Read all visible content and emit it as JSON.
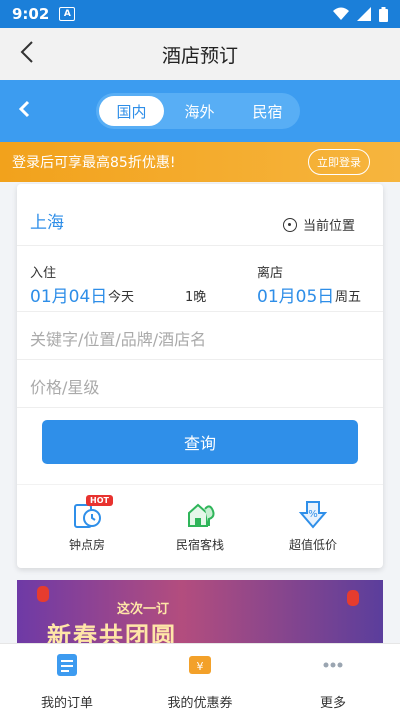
{
  "status": {
    "time": "9:02",
    "app_icon": "A"
  },
  "header": {
    "title": "酒店预订"
  },
  "tabs": [
    {
      "label": "国内",
      "active": true
    },
    {
      "label": "海外",
      "active": false
    },
    {
      "label": "民宿",
      "active": false
    }
  ],
  "promo": {
    "text": "登录后可享最高85折优惠!",
    "button": "立即登录"
  },
  "search": {
    "city": "上海",
    "location_label": "当前位置",
    "checkin_label": "入住",
    "checkin_date": "01月04日",
    "checkin_day": "今天",
    "nights": "1晚",
    "checkout_label": "离店",
    "checkout_date": "01月05日",
    "checkout_day": "周五",
    "keyword_placeholder": "关键字/位置/品牌/酒店名",
    "price_placeholder": "价格/星级",
    "search_button": "查询"
  },
  "quick_links": [
    {
      "label": "钟点房",
      "icon": "hourly-room-icon",
      "badge": "HOT"
    },
    {
      "label": "民宿客栈",
      "icon": "homestay-icon"
    },
    {
      "label": "超值低价",
      "icon": "discount-icon"
    }
  ],
  "banner": {
    "line1": "这次一订",
    "line2": "新春共团圆"
  },
  "bottom_nav": [
    {
      "label": "我的订单",
      "icon": "orders-icon"
    },
    {
      "label": "我的优惠券",
      "icon": "coupon-icon"
    },
    {
      "label": "更多",
      "icon": "more-icon"
    }
  ],
  "colors": {
    "primary": "#2f8fe9",
    "promo": "#f2a21c",
    "hot": "#e8322f"
  }
}
